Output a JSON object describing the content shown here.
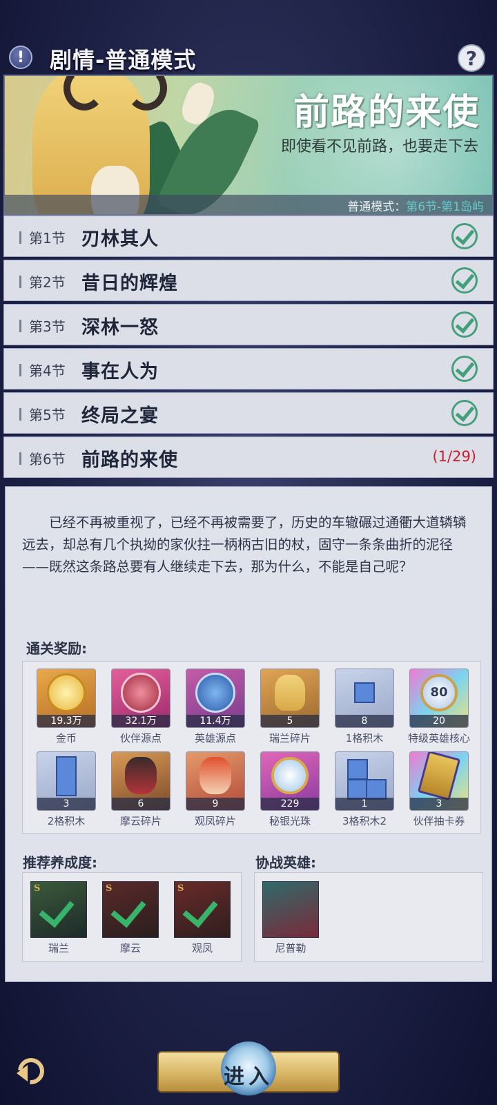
{
  "header": {
    "title": "剧情-普通模式",
    "warn_icon": "exclamation-icon",
    "help_icon": "question-icon"
  },
  "banner": {
    "chapter_title": "前路的来使",
    "subtitle": "即使看不见前路，也要走下去",
    "mode_prefix": "普通模式：",
    "mode_highlight": "第6节-第1岛屿"
  },
  "sections": [
    {
      "num": "第1节",
      "name": "刃林其人",
      "status": "done"
    },
    {
      "num": "第2节",
      "name": "昔日的辉煌",
      "status": "done"
    },
    {
      "num": "第3节",
      "name": "深林一怒",
      "status": "done"
    },
    {
      "num": "第4节",
      "name": "事在人为",
      "status": "done"
    },
    {
      "num": "第5节",
      "name": "终局之宴",
      "status": "done"
    },
    {
      "num": "第6节",
      "name": "前路的来使",
      "status": "progress",
      "progress": "(1/29)"
    }
  ],
  "detail": {
    "description": "已经不再被重视了，已经不再被需要了，历史的车辙碾过通衢大道辚辚远去，却总有几个执拗的家伙拄一柄柄古旧的杖，固守一条条曲折的泥径——既然这条路总要有人继续走下去，那为什么，不能是自己呢？",
    "rewards_label": "通关奖励:",
    "rewards": [
      {
        "name": "金币",
        "count": "19.3万",
        "icon": "gold-coin-icon"
      },
      {
        "name": "伙伴源点",
        "count": "32.1万",
        "icon": "partner-essence-icon"
      },
      {
        "name": "英雄源点",
        "count": "11.4万",
        "icon": "hero-essence-icon"
      },
      {
        "name": "瑞兰碎片",
        "count": "5",
        "icon": "hero-shard-icon"
      },
      {
        "name": "1格积木",
        "count": "8",
        "icon": "block-icon"
      },
      {
        "name": "特级英雄核心",
        "count": "20",
        "icon": "hero-core-icon"
      },
      {
        "name": "2格积木",
        "count": "3",
        "icon": "block-icon"
      },
      {
        "name": "摩云碎片",
        "count": "6",
        "icon": "hero-shard-icon"
      },
      {
        "name": "观凤碎片",
        "count": "9",
        "icon": "hero-shard-icon"
      },
      {
        "name": "秘银光珠",
        "count": "229",
        "icon": "mithril-orb-icon"
      },
      {
        "name": "3格积木2",
        "count": "1",
        "icon": "block-icon"
      },
      {
        "name": "伙伴抽卡券",
        "count": "3",
        "icon": "card-ticket-icon"
      }
    ],
    "recommend_label": "推荐养成度:",
    "recommend_heroes": [
      {
        "name": "瑞兰"
      },
      {
        "name": "摩云"
      },
      {
        "name": "观凤"
      }
    ],
    "coop_label": "协战英雄:",
    "coop_heroes": [
      {
        "name": "尼普勒"
      }
    ]
  },
  "footer": {
    "enter_label": "进入",
    "back_icon": "back-arrow-icon"
  },
  "colors": {
    "check": "#42a07a",
    "progress": "#c8202d",
    "mode_highlight": "#67c9c9"
  }
}
